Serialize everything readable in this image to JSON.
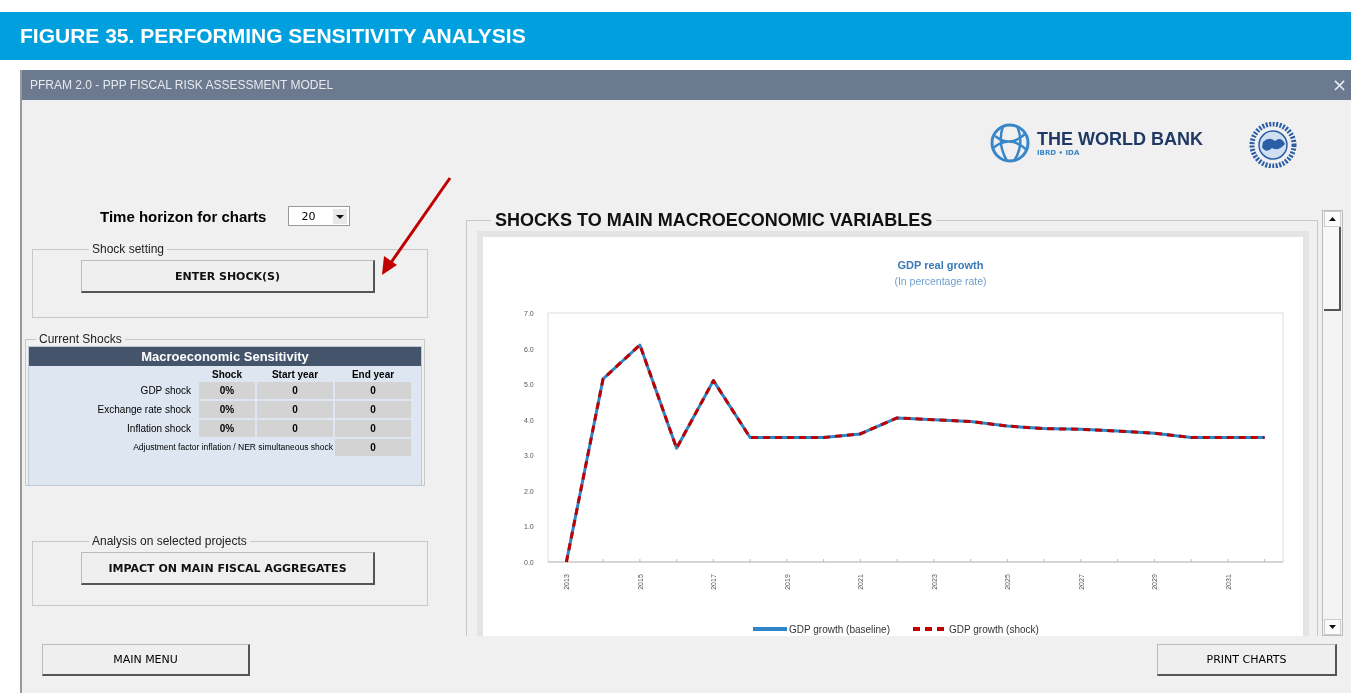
{
  "figure_caption": "FIGURE 35. PERFORMING SENSITIVITY ANALYSIS",
  "window": {
    "title": "PFRAM 2.0 - PPP FISCAL RISK ASSESSMENT MODEL",
    "close": "×"
  },
  "logos": {
    "world_bank": "THE WORLD BANK",
    "world_bank_sub": "IBRD • IDA"
  },
  "time_horizon": {
    "label": "Time horizon for charts",
    "value": "20"
  },
  "shock_setting": {
    "legend": "Shock setting",
    "button": "ENTER SHOCK(S)"
  },
  "current_shocks": {
    "legend": "Current Shocks",
    "table": {
      "title": "Macroeconomic Sensitivity",
      "columns": [
        "Shock",
        "Start year",
        "End year"
      ],
      "rows": [
        {
          "kind": "full",
          "label": "GDP shock",
          "cells": [
            "0%",
            "0",
            "0"
          ]
        },
        {
          "kind": "full",
          "label": "Exchange rate shock",
          "cells": [
            "0%",
            "0",
            "0"
          ]
        },
        {
          "kind": "full",
          "label": "Inflation shock",
          "cells": [
            "0%",
            "0",
            "0"
          ]
        },
        {
          "kind": "last",
          "label": "Adjustment factor inflation / NER simultaneous shock",
          "cells": [
            "",
            "",
            "0"
          ]
        }
      ]
    }
  },
  "analysis": {
    "legend": "Analysis on selected projects",
    "button": "IMPACT ON MAIN FISCAL AGGREGATES"
  },
  "chart_section": {
    "heading": "SHOCKS TO MAIN MACROECONOMIC VARIABLES",
    "chart_data": {
      "type": "line",
      "title": "GDP real growth",
      "subtitle": "(In percentage rate)",
      "x": [
        2013,
        2014,
        2015,
        2016,
        2017,
        2018,
        2019,
        2020,
        2021,
        2022,
        2023,
        2024,
        2025,
        2026,
        2027,
        2028,
        2029,
        2030,
        2031,
        2032
      ],
      "xlim": [
        2012.5,
        2032.5
      ],
      "legend": true,
      "xticks": [
        2013,
        2015,
        2017,
        2019,
        2021,
        2023,
        2025,
        2027,
        2029,
        2031
      ],
      "ylim": [
        0,
        7
      ],
      "yticks": [
        {
          "value": 0,
          "label": "0.0"
        },
        {
          "value": 1,
          "label": "1.0"
        },
        {
          "value": 2,
          "label": "2.0"
        },
        {
          "value": 3,
          "label": "3.0"
        },
        {
          "value": 4,
          "label": "4.0"
        },
        {
          "value": 5,
          "label": "5.0"
        },
        {
          "value": 6,
          "label": "6.0"
        },
        {
          "value": 7,
          "label": "7.0"
        }
      ],
      "series": [
        {
          "name": "GDP growth (baseline)",
          "color": "#2e86c8",
          "line_style": "solid",
          "values": [
            0.0,
            5.15,
            6.1,
            3.2,
            5.1,
            3.5,
            3.5,
            3.5,
            3.6,
            4.05,
            4.0,
            3.95,
            3.82,
            3.75,
            3.73,
            3.68,
            3.62,
            3.5,
            3.5,
            3.5
          ]
        },
        {
          "name": "GDP growth (shock)",
          "color": "#c00000",
          "line_style": "dashed",
          "values": [
            0.0,
            5.15,
            6.1,
            3.2,
            5.1,
            3.5,
            3.5,
            3.5,
            3.6,
            4.05,
            4.0,
            3.95,
            3.82,
            3.75,
            3.73,
            3.68,
            3.62,
            3.5,
            3.5,
            3.5
          ]
        }
      ]
    }
  },
  "buttons": [
    "MAIN MENU",
    "PRINT CHARTS"
  ]
}
